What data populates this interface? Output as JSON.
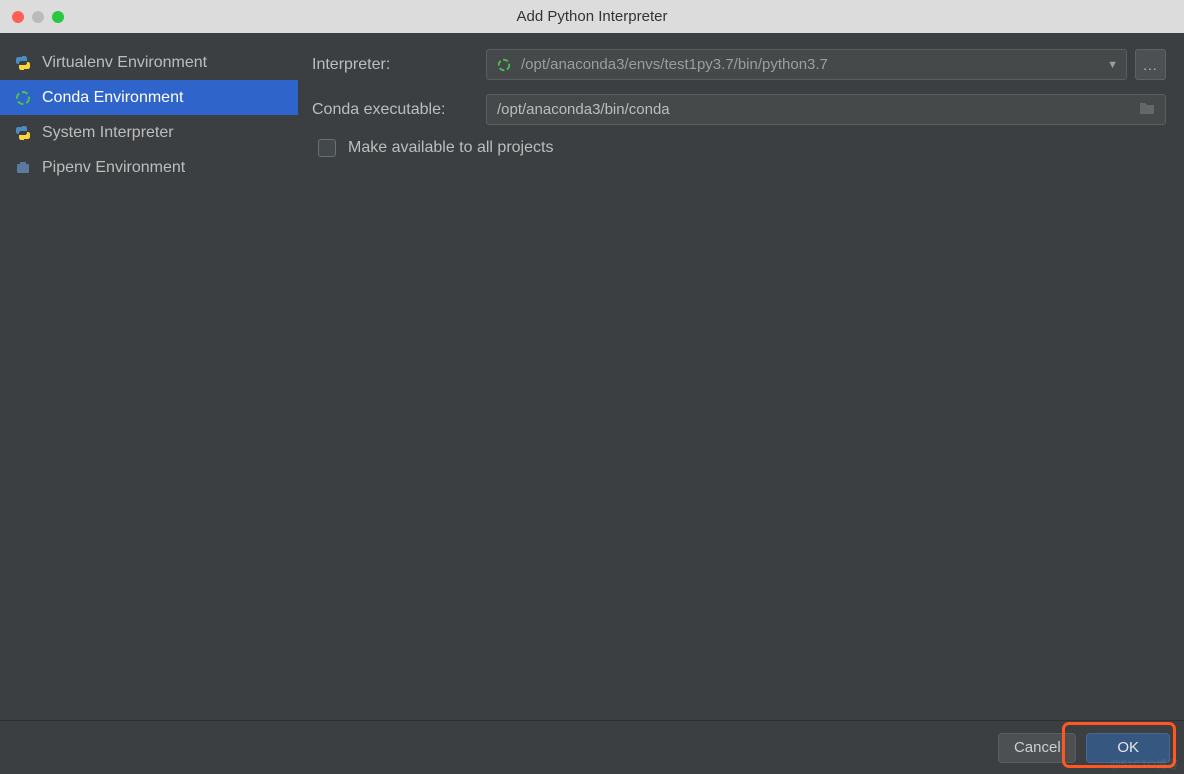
{
  "window": {
    "title": "Add Python Interpreter"
  },
  "sidebar": {
    "items": [
      {
        "label": "Virtualenv Environment"
      },
      {
        "label": "Conda Environment"
      },
      {
        "label": "System Interpreter"
      },
      {
        "label": "Pipenv Environment"
      }
    ],
    "selected_index": 1
  },
  "form": {
    "interpreter_label": "Interpreter:",
    "interpreter_value": "/opt/anaconda3/envs/test1py3.7/bin/python3.7",
    "conda_exec_label": "Conda executable:",
    "conda_exec_value": "/opt/anaconda3/bin/conda",
    "make_available_label": "Make available to all projects",
    "make_available_checked": false
  },
  "buttons": {
    "cancel": "Cancel",
    "ok": "OK",
    "more": "..."
  },
  "watermark": "@51CTO博客"
}
